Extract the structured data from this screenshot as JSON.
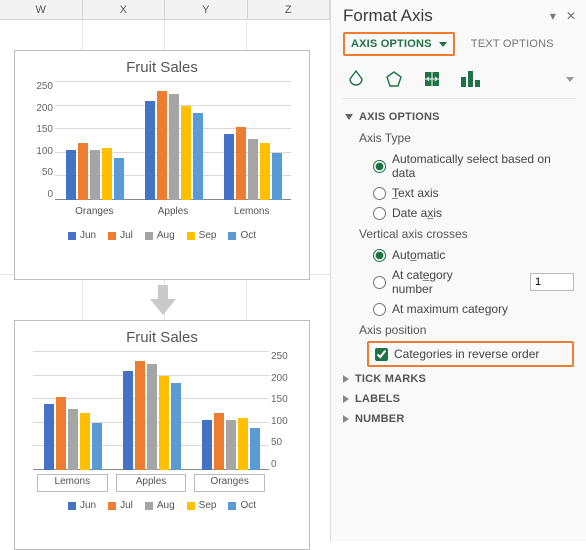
{
  "columns": [
    "W",
    "X",
    "Y",
    "Z"
  ],
  "chart_data": [
    {
      "type": "bar",
      "title": "Fruit Sales",
      "categories": [
        "Oranges",
        "Apples",
        "Lemons"
      ],
      "series": [
        {
          "name": "Jun",
          "values": [
            105,
            210,
            140
          ]
        },
        {
          "name": "Jul",
          "values": [
            120,
            230,
            155
          ]
        },
        {
          "name": "Aug",
          "values": [
            105,
            225,
            130
          ]
        },
        {
          "name": "Sep",
          "values": [
            110,
            200,
            120
          ]
        },
        {
          "name": "Oct",
          "values": [
            90,
            185,
            100
          ]
        }
      ],
      "ylabel": "",
      "xlabel": "",
      "ylim": [
        0,
        250
      ],
      "yticks": [
        0,
        50,
        100,
        150,
        200,
        250
      ],
      "yaxis_side": "left",
      "colors": [
        "#4472c4",
        "#ed7d31",
        "#a5a5a5",
        "#ffc000",
        "#5b9bd5"
      ]
    },
    {
      "type": "bar",
      "title": "Fruit Sales",
      "categories": [
        "Lemons",
        "Apples",
        "Oranges"
      ],
      "series": [
        {
          "name": "Jun",
          "values": [
            140,
            210,
            105
          ]
        },
        {
          "name": "Jul",
          "values": [
            155,
            230,
            120
          ]
        },
        {
          "name": "Aug",
          "values": [
            130,
            225,
            105
          ]
        },
        {
          "name": "Sep",
          "values": [
            120,
            200,
            110
          ]
        },
        {
          "name": "Oct",
          "values": [
            100,
            185,
            90
          ]
        }
      ],
      "ylabel": "",
      "xlabel": "",
      "ylim": [
        0,
        250
      ],
      "yticks": [
        0,
        50,
        100,
        150,
        200,
        250
      ],
      "yaxis_side": "right",
      "colors": [
        "#4472c4",
        "#ed7d31",
        "#a5a5a5",
        "#ffc000",
        "#5b9bd5"
      ]
    }
  ],
  "pane": {
    "title": "Format Axis",
    "tabs": {
      "axis_options": "AXIS OPTIONS",
      "text_options": "TEXT OPTIONS"
    },
    "sections": {
      "axis_options": {
        "title": "AXIS OPTIONS",
        "axis_type_label": "Axis Type",
        "axis_type": {
          "auto": "Automatically select based on data",
          "text": "Text axis",
          "date": "Date axis",
          "selected": "auto"
        },
        "vertical_crosses_label": "Vertical axis crosses",
        "vertical_crosses": {
          "automatic": "Automatic",
          "at_category": "At category number",
          "at_category_value": "1",
          "at_maximum": "At maximum category",
          "selected": "automatic"
        },
        "axis_position_label": "Axis position",
        "reverse_label": "Categories in reverse order",
        "reverse_checked": true
      },
      "tick_marks": "TICK MARKS",
      "labels": "LABELS",
      "number": "NUMBER"
    }
  }
}
